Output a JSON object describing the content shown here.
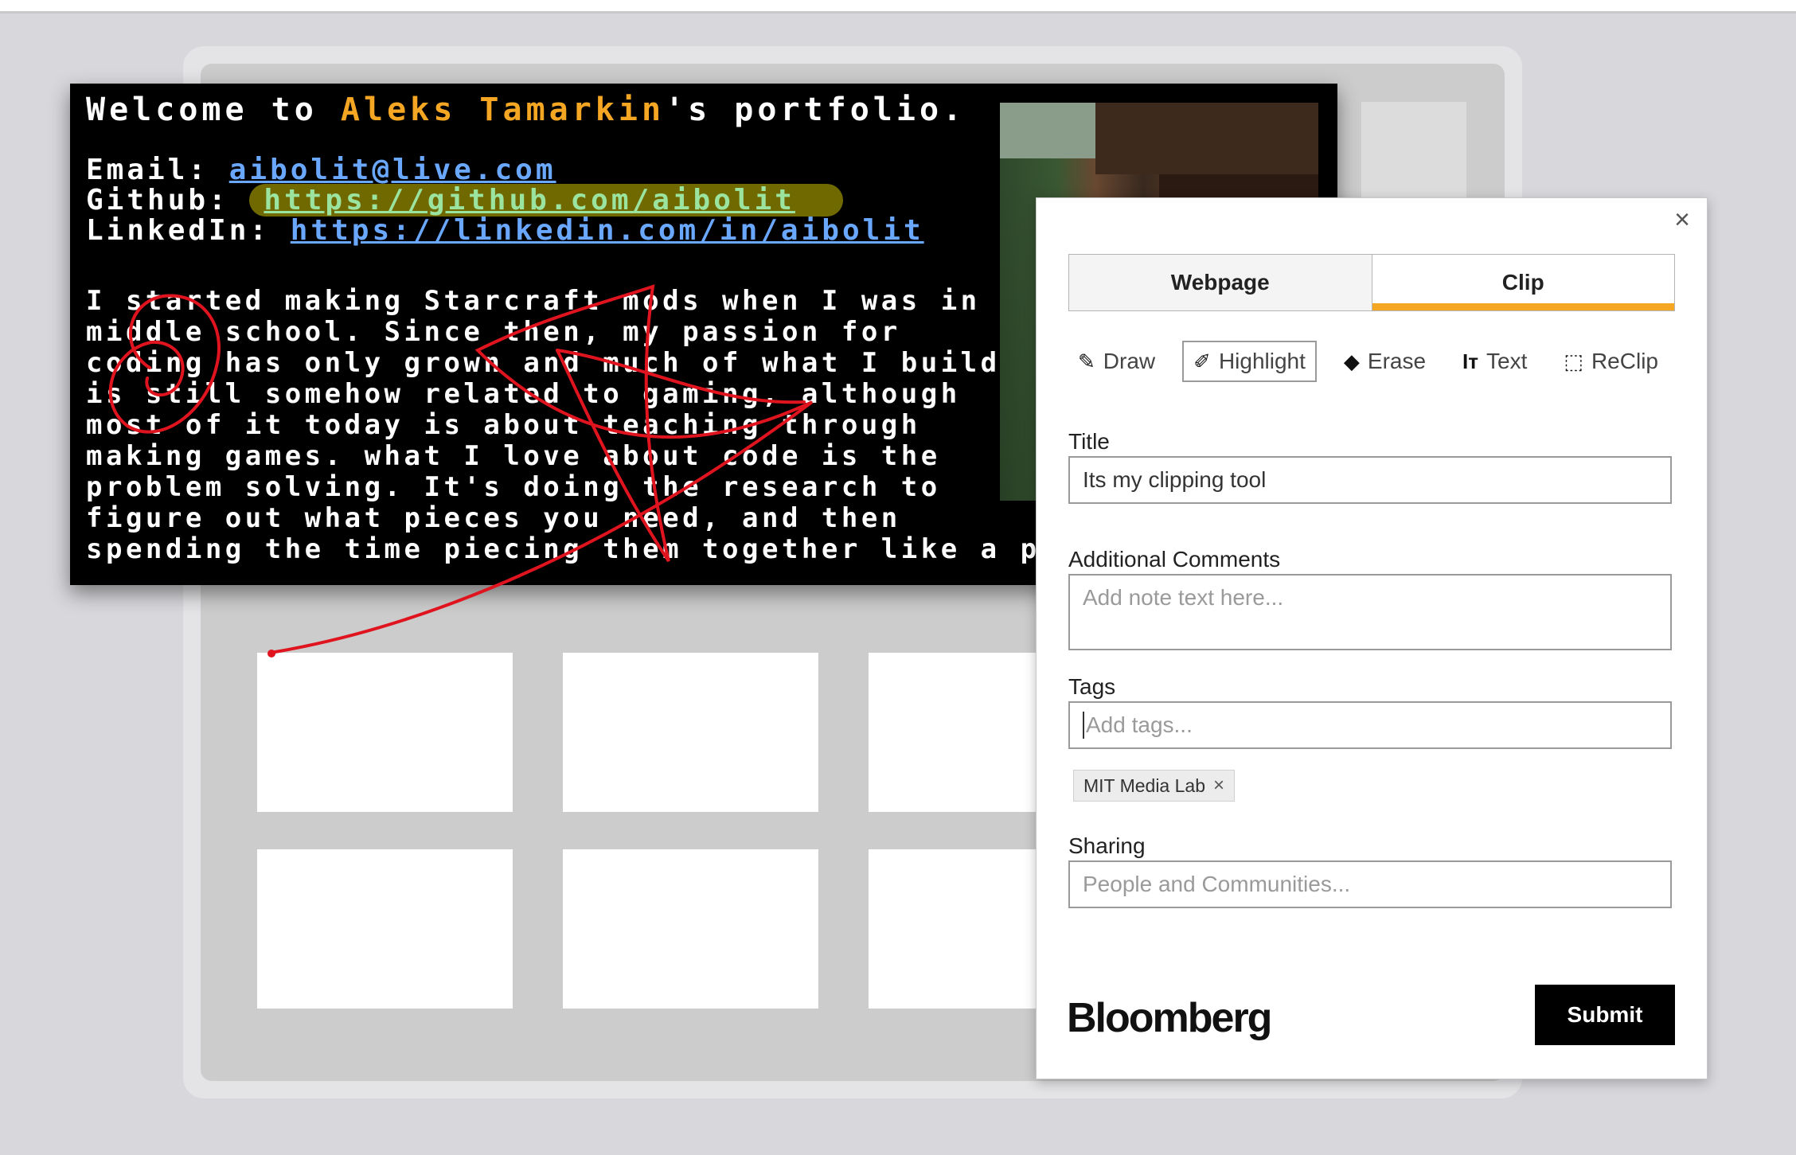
{
  "clip": {
    "welcome_prefix": "Welcome to ",
    "name": "Aleks Tamarkin",
    "welcome_suffix": "'s portfolio.",
    "email_label": "Email: ",
    "email": "aibolit@live.com",
    "github_label": "Github: ",
    "github": "https://github.com/aibolit",
    "linkedin_label": "LinkedIn: ",
    "linkedin": "https://linkedin.com/in/aibolit",
    "paragraph": [
      "I started making Starcraft mods when I was in",
      "middle school. Since then, my passion for",
      "coding has only grown and much of what I build",
      "is still somehow related to gaming, although",
      "most of it today is about teaching through",
      "making games. what I love about code is the",
      "problem solving. It's doing the research to",
      "figure out what pieces you need, and then",
      "spending the time piecing them together like a puz"
    ],
    "accent_color": "#f5a623",
    "link_color": "#6aa8ff",
    "ink_color": "#e0141e"
  },
  "panel": {
    "close_icon": "close-icon",
    "tabs": [
      "Webpage",
      "Clip"
    ],
    "active_tab": "Clip",
    "tools": [
      {
        "label": "Draw",
        "icon": "pencil-icon"
      },
      {
        "label": "Highlight",
        "icon": "marker-icon"
      },
      {
        "label": "Erase",
        "icon": "eraser-icon"
      },
      {
        "label": "Text",
        "icon": "text-icon"
      },
      {
        "label": "ReClip",
        "icon": "reclip-icon"
      }
    ],
    "active_tool": "Highlight",
    "title_label": "Title",
    "title_value": "Its my clipping tool",
    "comments_label": "Additional Comments",
    "comments_placeholder": "Add note text here...",
    "tags_label": "Tags",
    "tags_placeholder": "Add tags...",
    "tags": [
      "MIT Media Lab"
    ],
    "sharing_label": "Sharing",
    "sharing_placeholder": "People and Communities...",
    "brand": "Bloomberg",
    "submit_label": "Submit",
    "accent_color": "#f5a623"
  }
}
